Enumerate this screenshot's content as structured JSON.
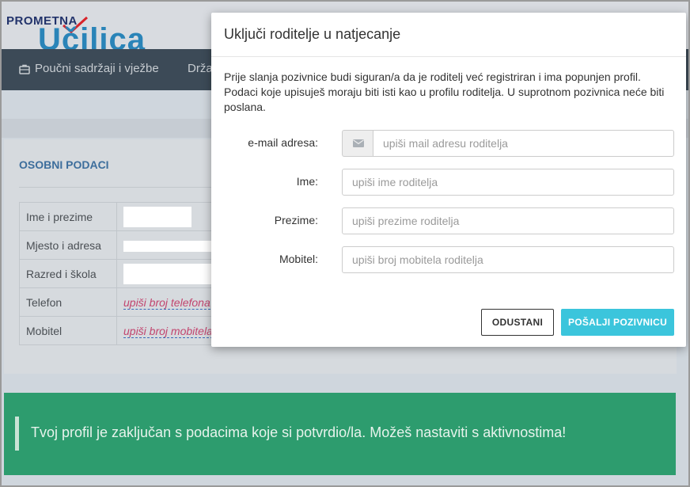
{
  "header": {
    "logo_small": "PROMETNA",
    "logo_big": "Učilica"
  },
  "nav": {
    "items": [
      {
        "label": "Poučni sadržaji i vježbe",
        "icon": "briefcase-icon"
      },
      {
        "label": "Drža"
      }
    ]
  },
  "profile": {
    "title": "OSOBNI PODACI",
    "rows": [
      {
        "label": "Ime i prezime",
        "value": ""
      },
      {
        "label": "Mjesto i adresa",
        "value": ""
      },
      {
        "label": "Razred i škola",
        "value": ""
      },
      {
        "label": "Telefon",
        "value": "upiši broj telefona"
      },
      {
        "label": "Mobitel",
        "value": "upiši broj mobitela"
      }
    ]
  },
  "alert": {
    "text": "Tvoj profil je zaključan s podacima koje si potvrdio/la. Možeš nastaviti s aktivnostima!"
  },
  "modal": {
    "title": "Uključi roditelje u natjecanje",
    "intro": "Prije slanja pozivnice budi siguran/a da je roditelj već registriran i ima popunjen profil. Podaci koje upisuješ moraju biti isti kao u profilu roditelja. U suprotnom pozivnica neće biti poslana.",
    "fields": {
      "email": {
        "label": "e-mail adresa:",
        "placeholder": "upiši mail adresu roditelja",
        "value": "",
        "icon": "envelope-icon"
      },
      "first_name": {
        "label": "Ime:",
        "placeholder": "upiši ime roditelja",
        "value": ""
      },
      "last_name": {
        "label": "Prezime:",
        "placeholder": "upiši prezime roditelja",
        "value": ""
      },
      "mobile": {
        "label": "Mobitel:",
        "placeholder": "upiši broj mobitela roditelja",
        "value": ""
      }
    },
    "buttons": {
      "cancel": "ODUSTANI",
      "send": "POŠALJI POZIVNICU"
    },
    "colors": {
      "primary": "#3bc5dc",
      "success": "#2d9c6e",
      "navbar": "#3c4a57"
    }
  }
}
